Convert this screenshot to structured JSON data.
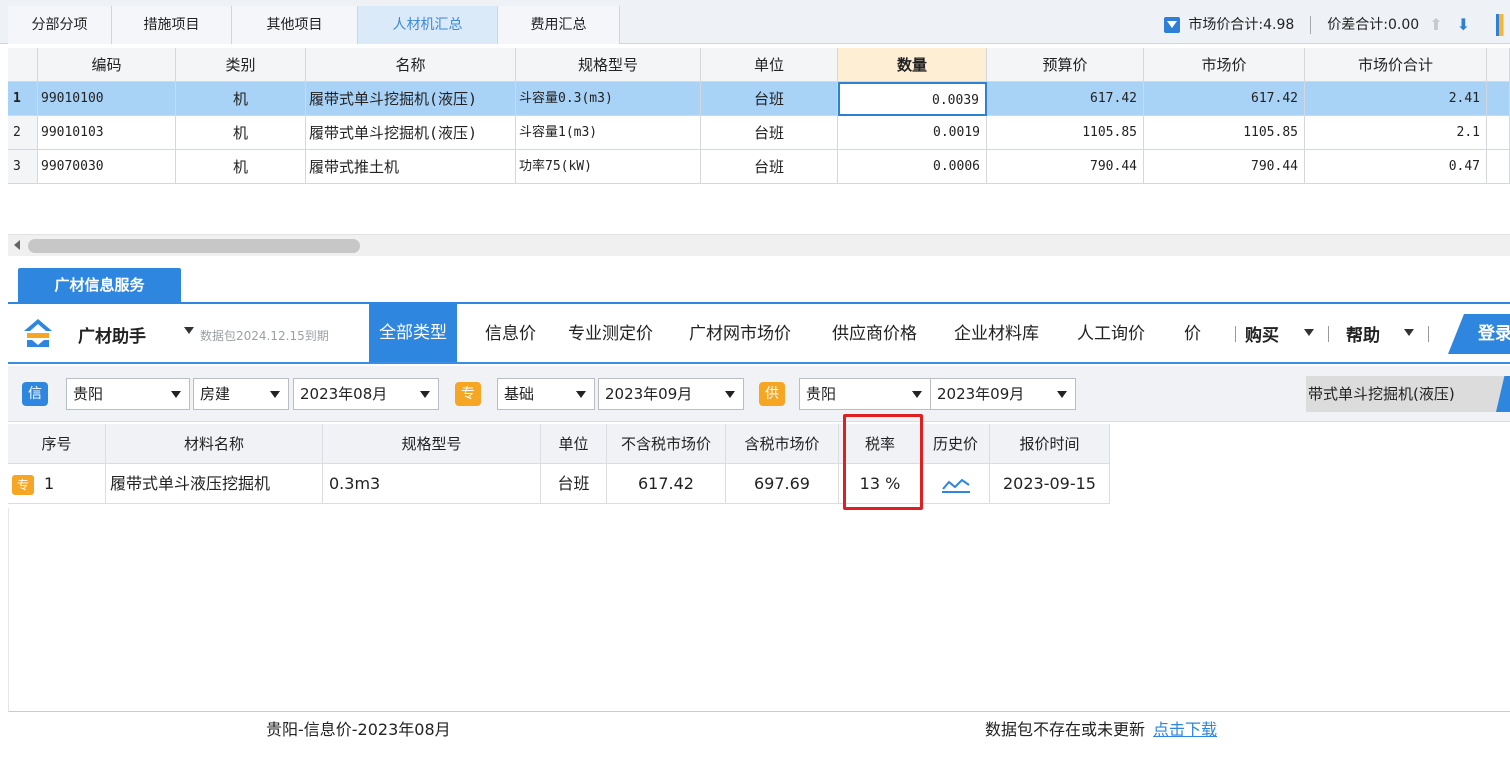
{
  "top_tabs": [
    {
      "label": "分部分项"
    },
    {
      "label": "措施项目"
    },
    {
      "label": "其他项目"
    },
    {
      "label": "人材机汇总"
    },
    {
      "label": "费用汇总"
    }
  ],
  "summary": {
    "market_total": "市场价合计:4.98",
    "diff_total": "价差合计:0.00"
  },
  "grid1": {
    "headers": [
      "编码",
      "类别",
      "名称",
      "规格型号",
      "单位",
      "数量",
      "预算价",
      "市场价",
      "市场价合计"
    ],
    "rows": [
      {
        "num": "1",
        "code": "99010100",
        "type": "机",
        "name": "履带式单斗挖掘机(液压)",
        "spec": "斗容量0.3(m3)",
        "unit": "台班",
        "qty": "0.0039",
        "budget": "617.42",
        "market": "617.42",
        "total": "2.41"
      },
      {
        "num": "2",
        "code": "99010103",
        "type": "机",
        "name": "履带式单斗挖掘机(液压)",
        "spec": "斗容量1(m3)",
        "unit": "台班",
        "qty": "0.0019",
        "budget": "1105.85",
        "market": "1105.85",
        "total": "2.1"
      },
      {
        "num": "3",
        "code": "99070030",
        "type": "机",
        "name": "履带式推土机",
        "spec": "功率75(kW)",
        "unit": "台班",
        "qty": "0.0006",
        "budget": "790.44",
        "market": "790.44",
        "total": "0.47"
      }
    ]
  },
  "service": {
    "tab_label": "广材信息服务",
    "assistant_label": "广材助手",
    "package_note": "数据包2024.12.15到期",
    "categories": [
      "全部类型",
      "信息价",
      "专业测定价",
      "广材网市场价",
      "供应商价格",
      "企业材料库",
      "人工询价",
      "价"
    ],
    "buy_label": "购买",
    "help_label": "帮助",
    "login_label": "登录"
  },
  "filters": {
    "xin_badge": "信",
    "zhuan_badge": "专",
    "gong_badge": "供",
    "region1": "贵阳",
    "category1": "房建",
    "period1": "2023年08月",
    "category2": "基础",
    "period2": "2023年09月",
    "region3": "贵阳",
    "period3": "2023年09月",
    "search_chip": "带式单斗挖掘机(液压)"
  },
  "grid2": {
    "headers": [
      "序号",
      "材料名称",
      "规格型号",
      "单位",
      "不含税市场价",
      "含税市场价",
      "税率",
      "历史价",
      "报价时间"
    ],
    "rows": [
      {
        "tag": "专",
        "num": "1",
        "name": "履带式单斗液压挖掘机",
        "spec": "0.3m3",
        "unit": "台班",
        "price_excl": "617.42",
        "price_incl": "697.69",
        "tax": "13 %",
        "quote_time": "2023-09-15"
      }
    ]
  },
  "status": {
    "left": "贵阳-信息价-2023年08月",
    "right": "数据包不存在或未更新",
    "link": "点击下载"
  }
}
